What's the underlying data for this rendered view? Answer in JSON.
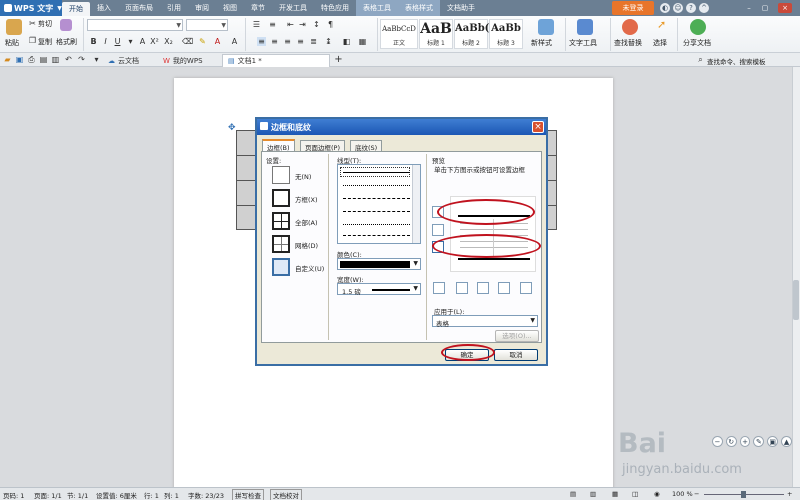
{
  "app": {
    "name": "WPS 文字"
  },
  "menu": {
    "tabs": [
      "开始",
      "插入",
      "页面布局",
      "引用",
      "审阅",
      "视图",
      "章节",
      "开发工具",
      "特色应用",
      "表格工具",
      "表格样式",
      "文档助手"
    ],
    "active": "开始",
    "login": "未登录"
  },
  "ribbon": {
    "paste": "粘贴",
    "cut": "剪切",
    "copy": "复制",
    "format_painter": "格式刷",
    "styles": [
      {
        "preview": "AaBbCcD",
        "name": "正文"
      },
      {
        "preview": "AaB",
        "name": "标题 1"
      },
      {
        "preview": "AaBb(",
        "name": "标题 2"
      },
      {
        "preview": "AaBb",
        "name": "标题 3"
      }
    ],
    "new_style": "新样式",
    "text_tools": "文字工具",
    "find_replace": "查找替换",
    "select": "选择",
    "share_doc": "分享文档"
  },
  "doc_tabs": {
    "items": [
      "云文档",
      "我的WPS",
      "文档1 *"
    ],
    "search_label": "查找命令、搜索模板"
  },
  "dialog": {
    "title": "边框和底纹",
    "close": "×",
    "tabs": [
      "边框(B)",
      "页面边框(P)",
      "底纹(S)"
    ],
    "settings_label": "设置:",
    "settings": [
      "无(N)",
      "方框(X)",
      "全部(A)",
      "网格(D)",
      "自定义(U)"
    ],
    "line_type_label": "线型(T):",
    "color_label": "颜色(C):",
    "width_label": "宽度(W):",
    "width_value": "1.5 磅",
    "preview_label": "预览",
    "preview_hint": "单击下方图示或按钮可设置边框",
    "apply_to_label": "应用于(L):",
    "apply_to_value": "表格",
    "options_button": "选项(O)...",
    "ok_button": "确定",
    "cancel_button": "取消"
  },
  "status": {
    "page_num": "页码: 1",
    "pages": "页面: 1/1",
    "section": "节: 1/1",
    "set_value": "设置值: 6厘米",
    "row": "行: 1",
    "col": "列: 1",
    "word_count": "字数: 23/23",
    "spell_check": "拼写检查",
    "doc_proof": "文档校对",
    "zoom": "100 %"
  },
  "watermark": {
    "brand": "Bai",
    "site": "jingyan.baidu.com"
  },
  "colors": {
    "accent": "#2f6fb3",
    "login": "#e8752a",
    "highlight_ring": "#c0121e"
  }
}
